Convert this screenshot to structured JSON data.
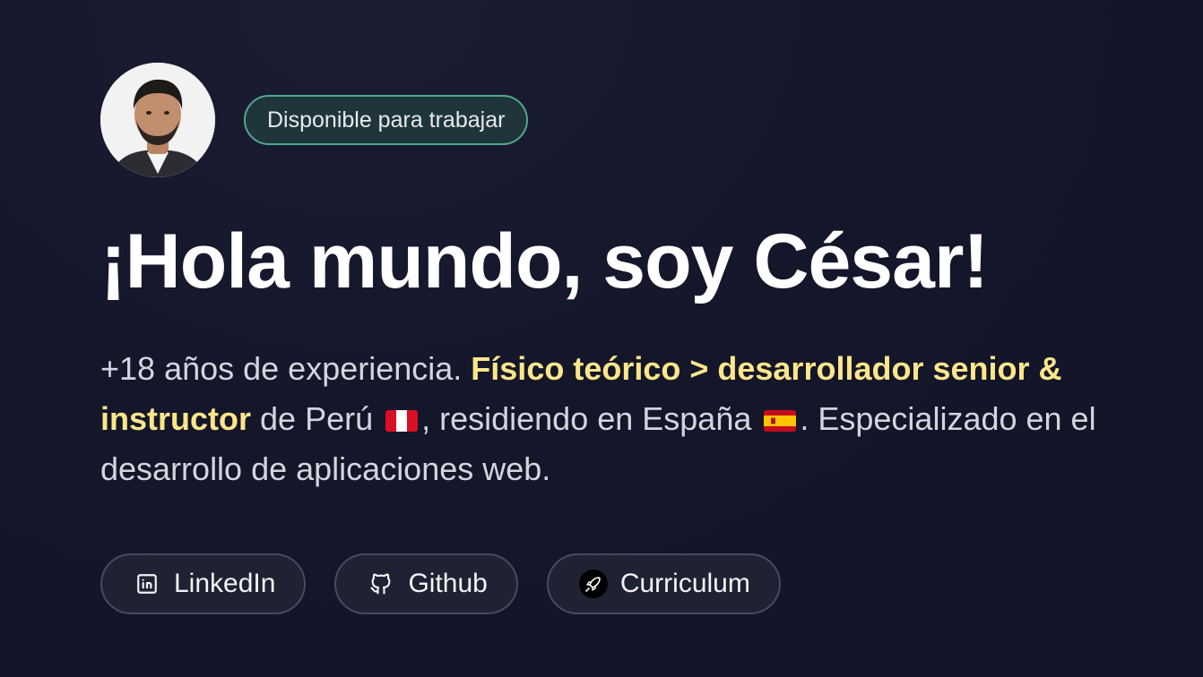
{
  "profile": {
    "avatar_icon": "person-photo",
    "status_badge": "Disponible para trabajar"
  },
  "hero": {
    "title": "¡Hola mundo, soy César!",
    "intro_part1": "+18 años de experiencia. ",
    "intro_highlight": "Físico teórico > desarrollador senior & instructor",
    "intro_part2": " de Perú ",
    "intro_part3": ", residiendo en España ",
    "intro_part4": ". Especializado en el desarrollo de aplicaciones web."
  },
  "links": [
    {
      "label": "LinkedIn",
      "icon": "linkedin-icon"
    },
    {
      "label": "Github",
      "icon": "github-icon"
    },
    {
      "label": "Curriculum",
      "icon": "rocket-icon"
    }
  ],
  "colors": {
    "background": "#14162a",
    "highlight": "#fde68a",
    "badge_border": "#4fa88b",
    "button_border": "#474b5c"
  }
}
